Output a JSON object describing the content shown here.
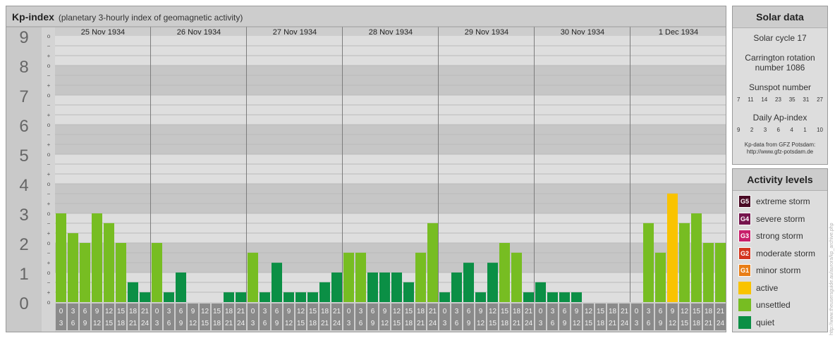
{
  "chart_data": {
    "type": "bar",
    "title": "Kp-index",
    "subtitle": "(planetary 3-hourly index of geomagnetic activity)",
    "days": [
      "25 Nov 1934",
      "26 Nov 1934",
      "27 Nov 1934",
      "28 Nov 1934",
      "29 Nov 1934",
      "30 Nov 1934",
      "1 Dec 1934"
    ],
    "hour_start_labels": [
      "0",
      "3",
      "6",
      "9",
      "12",
      "15",
      "18",
      "21"
    ],
    "hour_end_labels": [
      "3",
      "6",
      "9",
      "12",
      "15",
      "18",
      "21",
      "24"
    ],
    "y_major_labels": [
      "0",
      "1",
      "2",
      "3",
      "4",
      "5",
      "6",
      "7",
      "8",
      "9"
    ],
    "y_minor_labels": [
      "o",
      "+",
      "−",
      "o",
      "+",
      "−",
      "o",
      "+",
      "−",
      "o",
      "+",
      "−",
      "o",
      "+",
      "−",
      "o",
      "+",
      "−",
      "o",
      "+",
      "−",
      "o",
      "+",
      "−",
      "o",
      "+",
      "−",
      "o"
    ],
    "ylim": [
      0,
      9
    ],
    "values": [
      3.0,
      2.33,
      2.0,
      3.0,
      2.67,
      2.0,
      0.67,
      0.33,
      2.0,
      0.33,
      1.0,
      0.0,
      0.0,
      0.0,
      0.33,
      0.33,
      1.67,
      0.33,
      1.33,
      0.33,
      0.33,
      0.33,
      0.67,
      1.0,
      1.67,
      1.67,
      1.0,
      1.0,
      1.0,
      0.67,
      1.67,
      2.67,
      0.33,
      1.0,
      1.33,
      0.33,
      1.33,
      2.0,
      1.67,
      0.33,
      0.67,
      0.33,
      0.33,
      0.33,
      0.0,
      0.0,
      0.0,
      0.0,
      0.0,
      2.67,
      1.67,
      3.67,
      2.67,
      3.0,
      2.0,
      2.0
    ],
    "levels": [
      "unsettled",
      "unsettled",
      "unsettled",
      "unsettled",
      "unsettled",
      "unsettled",
      "quiet",
      "quiet",
      "unsettled",
      "quiet",
      "quiet",
      "quiet",
      "quiet",
      "quiet",
      "quiet",
      "quiet",
      "unsettled",
      "quiet",
      "quiet",
      "quiet",
      "quiet",
      "quiet",
      "quiet",
      "quiet",
      "unsettled",
      "unsettled",
      "quiet",
      "quiet",
      "quiet",
      "quiet",
      "unsettled",
      "unsettled",
      "quiet",
      "quiet",
      "quiet",
      "quiet",
      "quiet",
      "unsettled",
      "unsettled",
      "quiet",
      "quiet",
      "quiet",
      "quiet",
      "quiet",
      "quiet",
      "quiet",
      "quiet",
      "quiet",
      "quiet",
      "unsettled",
      "unsettled",
      "active",
      "unsettled",
      "unsettled",
      "unsettled",
      "unsettled"
    ]
  },
  "colors": {
    "quiet": "#0b8f45",
    "unsettled": "#77bd22",
    "active": "#f9c300",
    "minor_storm": "#e87e17",
    "moderate_storm": "#d3351f",
    "strong_storm": "#c81e6a",
    "severe_storm": "#75154d",
    "extreme_storm": "#4a0a24"
  },
  "solar": {
    "title": "Solar data",
    "cycle": "Solar cycle 17",
    "carrington": "Carrington rotation number 1086",
    "sunspot_title": "Sunspot number",
    "sunspot_values": [
      "7",
      "11",
      "14",
      "23",
      "35",
      "31",
      "27"
    ],
    "ap_title": "Daily Ap-index",
    "ap_values": [
      "9",
      "2",
      "3",
      "6",
      "4",
      "1",
      "10"
    ],
    "credit_line1": "Kp-data from GFZ Potsdam:",
    "credit_line2": "http://www.gfz-potsdam.de"
  },
  "activity": {
    "title": "Activity levels",
    "items": [
      {
        "code": "G5",
        "label": "extreme storm",
        "color": "#4a0a24"
      },
      {
        "code": "G4",
        "label": "severe storm",
        "color": "#75154d"
      },
      {
        "code": "G3",
        "label": "strong storm",
        "color": "#c81e6a"
      },
      {
        "code": "G2",
        "label": "moderate storm",
        "color": "#d3351f"
      },
      {
        "code": "G1",
        "label": "minor storm",
        "color": "#e87e17"
      },
      {
        "code": "",
        "label": "active",
        "color": "#f9c300"
      },
      {
        "code": "",
        "label": "unsettled",
        "color": "#77bd22"
      },
      {
        "code": "",
        "label": "quiet",
        "color": "#0b8f45"
      }
    ]
  },
  "watermark": "http://www.theusersguide.au/aurora/kp_archive.php"
}
